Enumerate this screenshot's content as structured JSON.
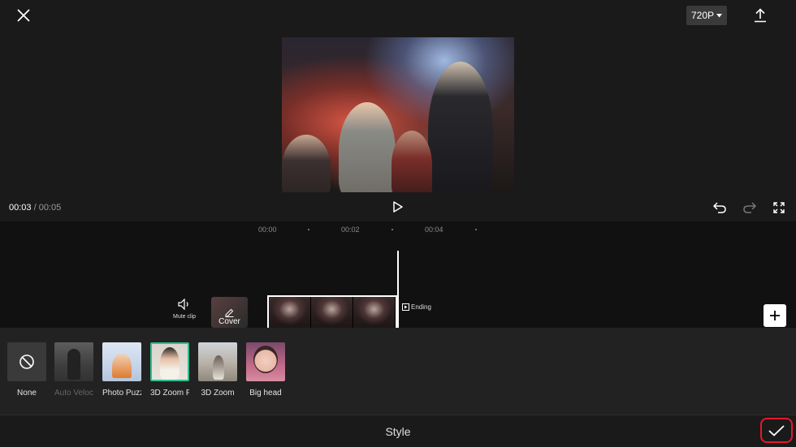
{
  "header": {
    "close_icon": "close-icon",
    "resolution": "720P",
    "export_icon": "upload-icon"
  },
  "player": {
    "current_time": "00:03",
    "total_time": " / 00:05",
    "play_icon": "play-icon",
    "undo_icon": "undo-icon",
    "redo_icon": "redo-icon",
    "fullscreen_icon": "fullscreen-icon"
  },
  "timeline": {
    "ruler": [
      "00:00",
      "00:02",
      "00:04"
    ],
    "mute_label": "Mute clip",
    "cover_label": "Cover",
    "ending_label": "Ending"
  },
  "effects": [
    {
      "label": "None"
    },
    {
      "label": "Auto Veloc..."
    },
    {
      "label": "Photo Puzz..."
    },
    {
      "label": "3D Zoom Pr..."
    },
    {
      "label": "3D Zoom"
    },
    {
      "label": "Big head"
    }
  ],
  "footer": {
    "title": "Style",
    "confirm_icon": "checkmark-icon"
  },
  "colors": {
    "accent_selected": "#2fbf8f",
    "confirm_outline": "#e5192a"
  }
}
